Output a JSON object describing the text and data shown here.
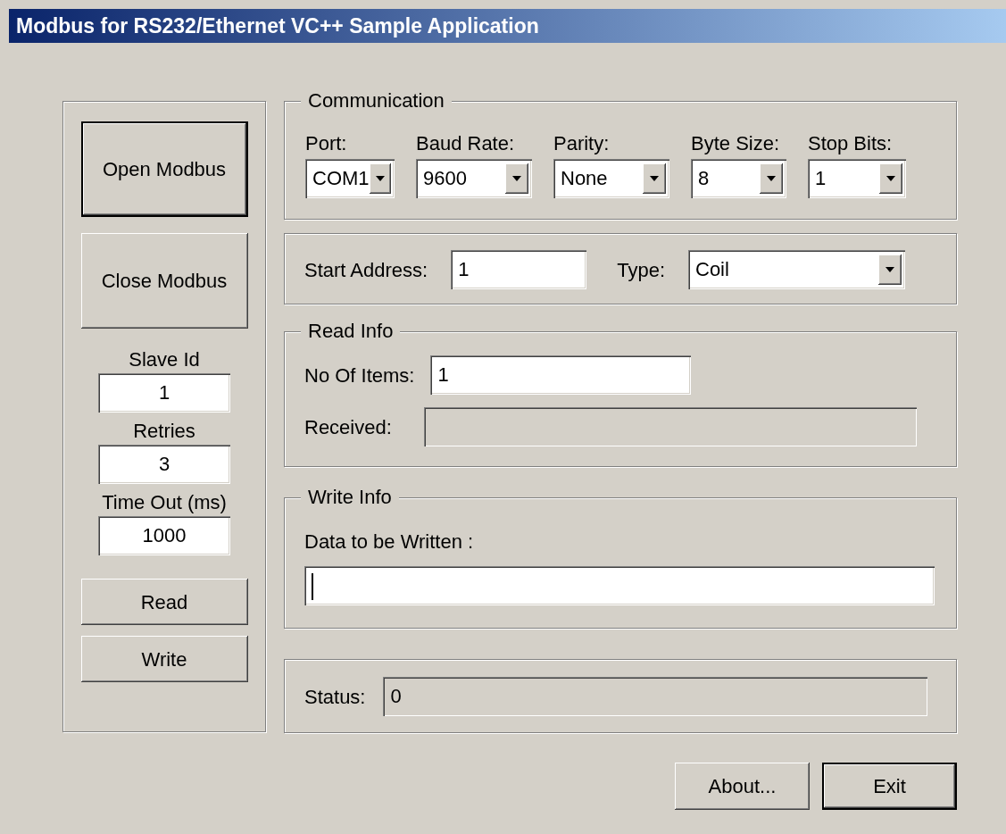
{
  "window": {
    "title": "Modbus for RS232/Ethernet VC++ Sample Application"
  },
  "left_panel": {
    "buttons": [
      {
        "label": "Open Modbus",
        "default": true
      },
      {
        "label": "Close Modbus",
        "default": false
      }
    ],
    "fields": [
      {
        "label": "Slave Id",
        "value": "1"
      },
      {
        "label": "Retries",
        "value": "3"
      },
      {
        "label": "Time Out (ms)",
        "value": "1000"
      }
    ],
    "actions": [
      {
        "label": "Read",
        "default": false
      },
      {
        "label": "Write",
        "default": false
      }
    ]
  },
  "communication": {
    "title": "Communication",
    "settings": [
      {
        "label": "Port:",
        "value": "COM1"
      },
      {
        "label": "Baud Rate:",
        "value": "9600"
      },
      {
        "label": "Parity:",
        "value": "None"
      },
      {
        "label": "Byte Size:",
        "value": "8"
      },
      {
        "label": "Stop Bits:",
        "value": "1"
      }
    ]
  },
  "address": {
    "start_label": "Start Address:",
    "start_value": "1",
    "type_label": "Type:",
    "type_value": "Coil"
  },
  "read_info": {
    "title": "Read Info",
    "items_label": "No Of Items:",
    "items_value": "1",
    "received_label": "Received:",
    "received_disabled": true
  },
  "write_info": {
    "title": "Write Info",
    "data_label": "Data to be Written :",
    "focused": true
  },
  "status": {
    "label": "Status:",
    "value": "0",
    "disabled": true
  },
  "footer_buttons": [
    {
      "label": "About...",
      "default": false
    },
    {
      "label": "Exit",
      "default": true
    }
  ]
}
